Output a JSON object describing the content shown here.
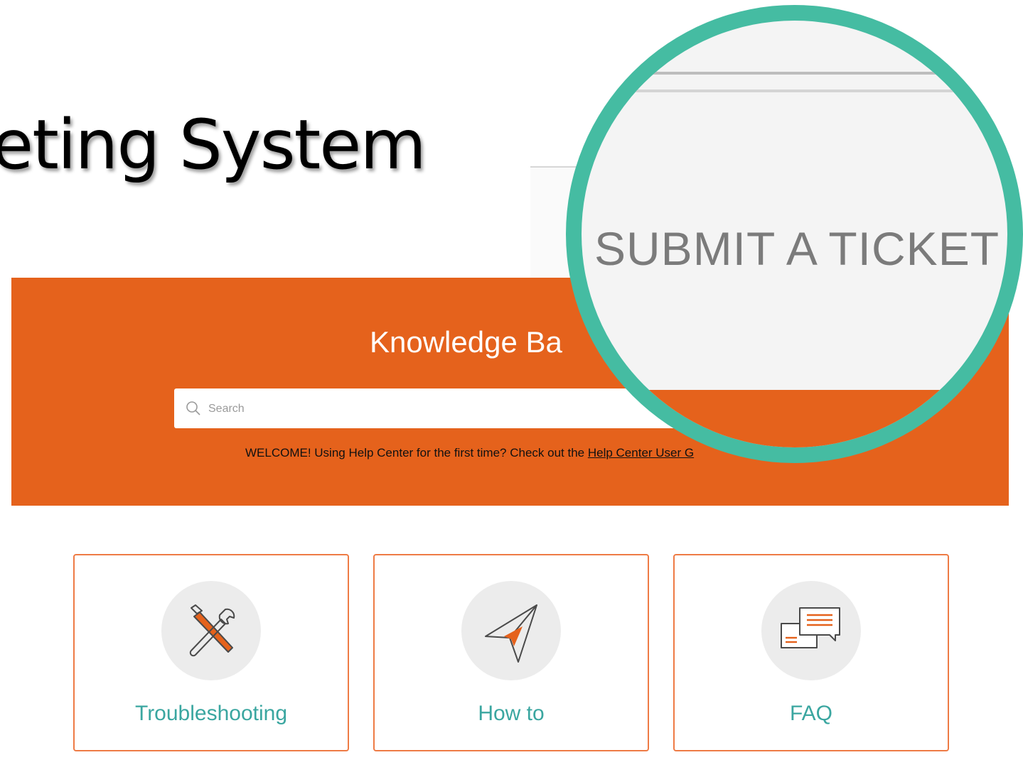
{
  "slide": {
    "title": "keting System"
  },
  "zoom": {
    "label": "SUBMIT A TICKET"
  },
  "banner": {
    "title": "Knowledge Ba",
    "search_placeholder": "Search",
    "welcome_text": "WELCOME! Using Help Center for the first time? Check out the ",
    "welcome_link": "Help Center User G"
  },
  "cards": [
    {
      "label": "Troubleshooting",
      "icon": "tools-icon"
    },
    {
      "label": "How to",
      "icon": "paper-plane-icon"
    },
    {
      "label": "FAQ",
      "icon": "chat-bubbles-icon"
    }
  ],
  "colors": {
    "accent": "#e5621c",
    "ring": "#45bca2",
    "card_text": "#3aa6a0",
    "card_border": "#ee7b45"
  }
}
